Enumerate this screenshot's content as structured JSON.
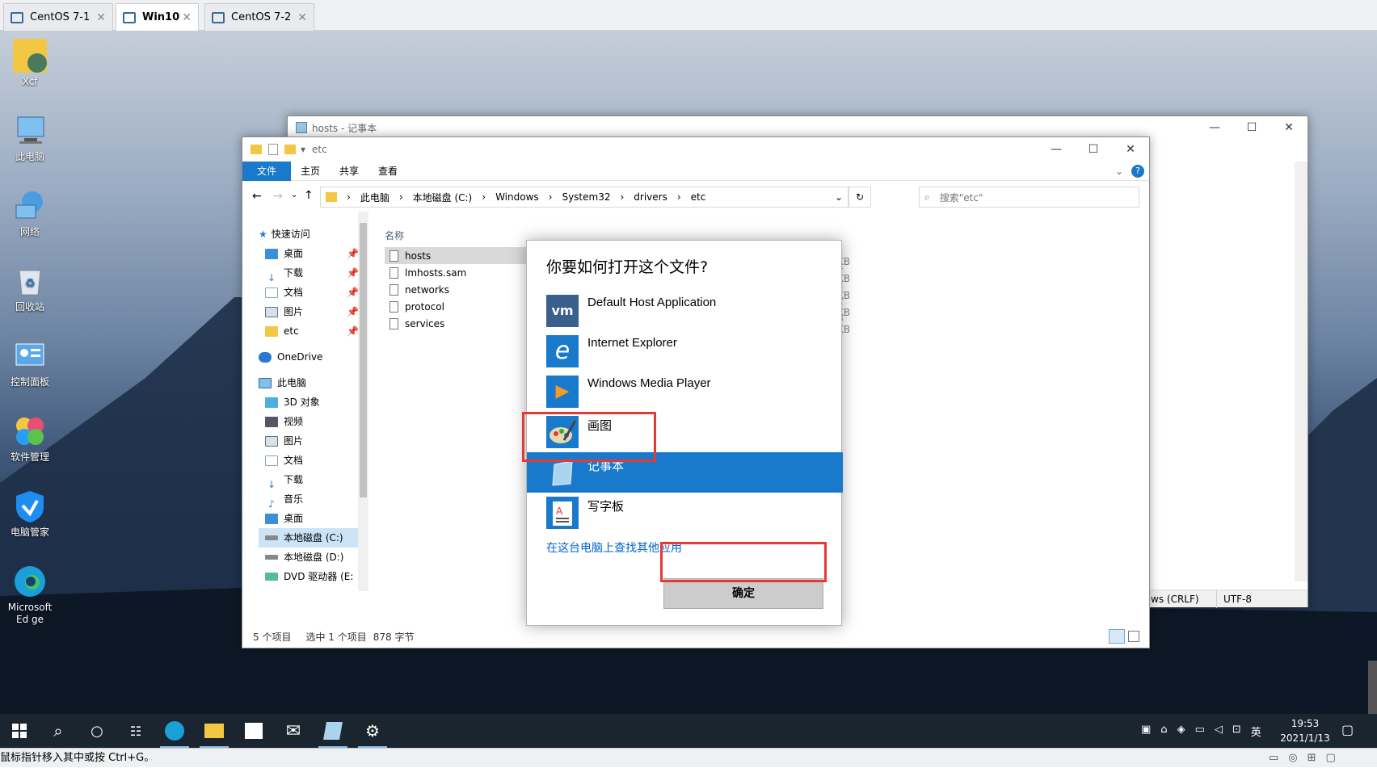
{
  "vm_tabs": [
    {
      "label": "CentOS 7-1"
    },
    {
      "label": "Win10"
    },
    {
      "label": "CentOS 7-2"
    }
  ],
  "desktop_icons": [
    {
      "label": "Xcf"
    },
    {
      "label": "此电脑"
    },
    {
      "label": "网络"
    },
    {
      "label": "回收站"
    },
    {
      "label": "控制面板"
    },
    {
      "label": "软件管理"
    },
    {
      "label": "电脑管家"
    },
    {
      "label": "Microsoft Ed ge"
    }
  ],
  "notepad": {
    "title": "hosts - 记事本",
    "status_encoding_eol": "ws (CRLF)",
    "status_charset": "UTF-8"
  },
  "explorer": {
    "title": "etc",
    "ribbon_tabs": [
      "文件",
      "主页",
      "共享",
      "查看"
    ],
    "breadcrumb": [
      "此电脑",
      "本地磁盘 (C:)",
      "Windows",
      "System32",
      "drivers",
      "etc"
    ],
    "search_placeholder": "搜索\"etc\"",
    "column_name": "名称",
    "quick_access": "快速访问",
    "quick_items": [
      "桌面",
      "下载",
      "文档",
      "图片",
      "etc"
    ],
    "onedrive": "OneDrive",
    "this_pc": "此电脑",
    "pc_items": [
      "3D 对象",
      "视频",
      "图片",
      "文档",
      "下载",
      "音乐",
      "桌面",
      "本地磁盘 (C:)",
      "本地磁盘 (D:)",
      "DVD 驱动器 (E:"
    ],
    "files": [
      {
        "name": "hosts",
        "size": "1 KB"
      },
      {
        "name": "lmhosts.sam",
        "size": "4 KB"
      },
      {
        "name": "networks",
        "size": "1 KB"
      },
      {
        "name": "protocol",
        "size": "2 KB"
      },
      {
        "name": "services",
        "size": "8 KB"
      }
    ],
    "status_items": "5 个项目",
    "status_selected": "选中 1 个项目",
    "status_bytes": "878 字节"
  },
  "dialog": {
    "title": "你要如何打开这个文件?",
    "apps": [
      {
        "label": "Default Host Application",
        "icon": "vmware-icon"
      },
      {
        "label": "Internet Explorer",
        "icon": "ie-icon"
      },
      {
        "label": "Windows Media Player",
        "icon": "media-player-icon"
      },
      {
        "label": "画图",
        "icon": "paint-icon"
      },
      {
        "label": "记事本",
        "icon": "notepad-icon"
      },
      {
        "label": "写字板",
        "icon": "wordpad-icon"
      }
    ],
    "selected_app": "记事本",
    "more_apps_link": "在这台电脑上查找其他应用",
    "ok_button": "确定"
  },
  "tray": {
    "ime": "英",
    "time": "19:53",
    "date": "2021/1/13"
  },
  "vm_status": "鼠标指针移入其中或按 Ctrl+G。",
  "colors": {
    "accent": "#1979ca",
    "highlight_box": "#e53935",
    "taskbar": "#1b2530"
  }
}
